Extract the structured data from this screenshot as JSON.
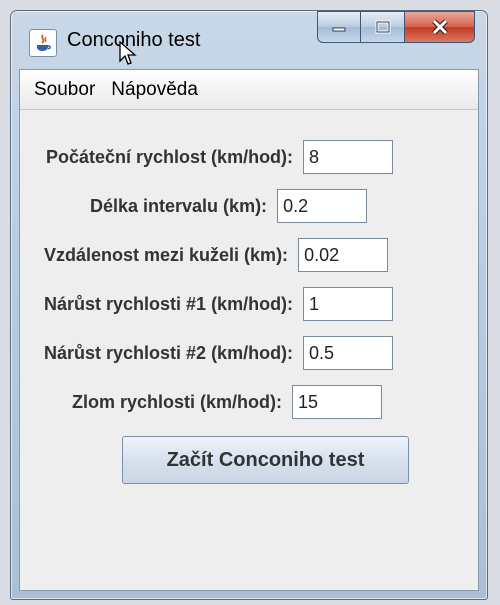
{
  "window": {
    "title": "Conconiho test",
    "icon": "java-icon",
    "controls": [
      "minimize",
      "maximize",
      "close"
    ]
  },
  "menu": {
    "items": [
      {
        "label": "Soubor"
      },
      {
        "label": "Nápověda"
      }
    ]
  },
  "form": {
    "fields": [
      {
        "label": "Počáteční rychlost (km/hod):",
        "value": "8"
      },
      {
        "label": "Délka intervalu (km):",
        "value": "0.2"
      },
      {
        "label": "Vzdálenost mezi kuželi (km):",
        "value": "0.02"
      },
      {
        "label": "Nárůst rychlosti #1 (km/hod):",
        "value": "1"
      },
      {
        "label": "Nárůst rychlosti #2 (km/hod):",
        "value": "0.5"
      },
      {
        "label": "Zlom rychlosti (km/hod):",
        "value": "15"
      }
    ],
    "start_label": "Začít Conconiho test"
  }
}
